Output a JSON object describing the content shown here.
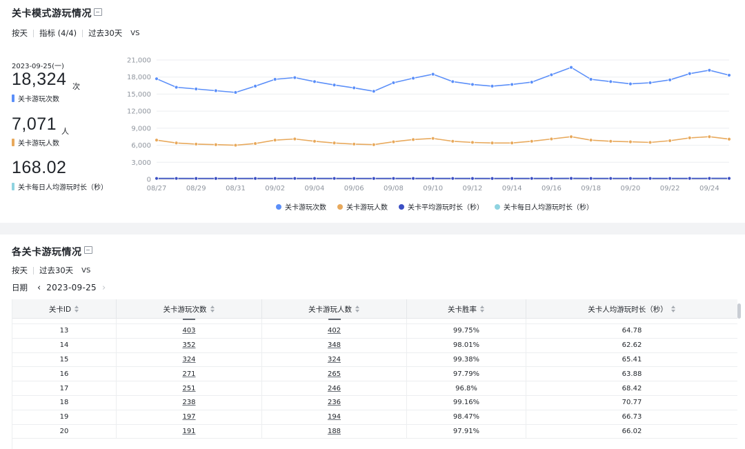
{
  "section1": {
    "title": "关卡模式游玩情况",
    "filters": [
      "按天",
      "指标 (4/4)",
      "过去30天"
    ],
    "vs": "VS",
    "date": "2023-09-25(一)",
    "kpis": [
      {
        "value": "18,324",
        "unit": "次",
        "label": "关卡游玩次数",
        "color": "#5b8ff9"
      },
      {
        "value": "7,071",
        "unit": "人",
        "label": "关卡游玩人数",
        "color": "#e8a95c"
      },
      {
        "value": "168.02",
        "unit": "",
        "label": "关卡每日人均游玩时长（秒）",
        "color": "#8fd3e0"
      }
    ]
  },
  "chart_data": {
    "type": "line",
    "x": [
      "08/27",
      "08/28",
      "08/29",
      "08/30",
      "08/31",
      "09/01",
      "09/02",
      "09/03",
      "09/04",
      "09/05",
      "09/06",
      "09/07",
      "09/08",
      "09/09",
      "09/10",
      "09/11",
      "09/12",
      "09/13",
      "09/14",
      "09/15",
      "09/16",
      "09/17",
      "09/18",
      "09/19",
      "09/20",
      "09/21",
      "09/22",
      "09/23",
      "09/24",
      "09/25"
    ],
    "x_tick_labels": [
      "08/27",
      "08/29",
      "08/31",
      "09/02",
      "09/04",
      "09/06",
      "09/08",
      "09/10",
      "09/12",
      "09/14",
      "09/16",
      "09/18",
      "09/20",
      "09/22",
      "09/24"
    ],
    "y_ticks": [
      "21,000",
      "18,000",
      "15,000",
      "12,000",
      "9,000",
      "6,000",
      "3,000",
      "0"
    ],
    "ylim": [
      0,
      21000
    ],
    "series": [
      {
        "name": "关卡游玩次数",
        "color": "#5b8ff9",
        "values": [
          17700,
          16200,
          15900,
          15600,
          15300,
          16400,
          17600,
          17900,
          17200,
          16600,
          16100,
          15500,
          17000,
          17800,
          18500,
          17200,
          16700,
          16400,
          16700,
          17100,
          18400,
          19700,
          17600,
          17200,
          16800,
          17000,
          17500,
          18600,
          19200,
          18324
        ]
      },
      {
        "name": "关卡游玩人数",
        "color": "#e8a95c",
        "values": [
          6900,
          6400,
          6200,
          6100,
          6000,
          6300,
          6900,
          7100,
          6700,
          6400,
          6200,
          6100,
          6600,
          7000,
          7200,
          6700,
          6500,
          6400,
          6400,
          6700,
          7100,
          7500,
          6900,
          6700,
          6600,
          6500,
          6800,
          7300,
          7500,
          7071
        ]
      },
      {
        "name": "关卡平均游玩时长（秒）",
        "color": "#3b4fc4",
        "values": [
          160,
          158,
          155,
          156,
          154,
          157,
          160,
          161,
          159,
          158,
          156,
          155,
          158,
          160,
          162,
          159,
          157,
          156,
          157,
          158,
          161,
          164,
          160,
          159,
          158,
          158,
          160,
          163,
          165,
          164
        ]
      },
      {
        "name": "关卡每日人均游玩时长（秒）",
        "color": "#8fd3e0",
        "values": [
          166,
          164,
          162,
          163,
          161,
          164,
          167,
          168,
          166,
          165,
          163,
          162,
          165,
          167,
          169,
          166,
          164,
          163,
          164,
          165,
          168,
          171,
          167,
          166,
          165,
          165,
          167,
          170,
          172,
          168
        ]
      }
    ],
    "grid": true,
    "legend_position": "bottom"
  },
  "section2": {
    "title": "各关卡游玩情况",
    "filters": [
      "按天",
      "过去30天"
    ],
    "vs": "VS",
    "date_label": "日期",
    "date_value": "2023-09-25",
    "columns": [
      "关卡ID",
      "关卡游玩次数",
      "关卡游玩人数",
      "关卡胜率",
      "关卡人均游玩时长（秒）"
    ],
    "rows": [
      [
        "13",
        "403",
        "402",
        "99.75%",
        "64.78"
      ],
      [
        "14",
        "352",
        "348",
        "98.01%",
        "62.62"
      ],
      [
        "15",
        "324",
        "324",
        "99.38%",
        "65.41"
      ],
      [
        "16",
        "271",
        "265",
        "97.79%",
        "63.88"
      ],
      [
        "17",
        "251",
        "246",
        "96.8%",
        "68.42"
      ],
      [
        "18",
        "238",
        "236",
        "99.16%",
        "70.77"
      ],
      [
        "19",
        "197",
        "194",
        "98.47%",
        "66.73"
      ],
      [
        "20",
        "191",
        "188",
        "97.91%",
        "66.02"
      ]
    ]
  }
}
